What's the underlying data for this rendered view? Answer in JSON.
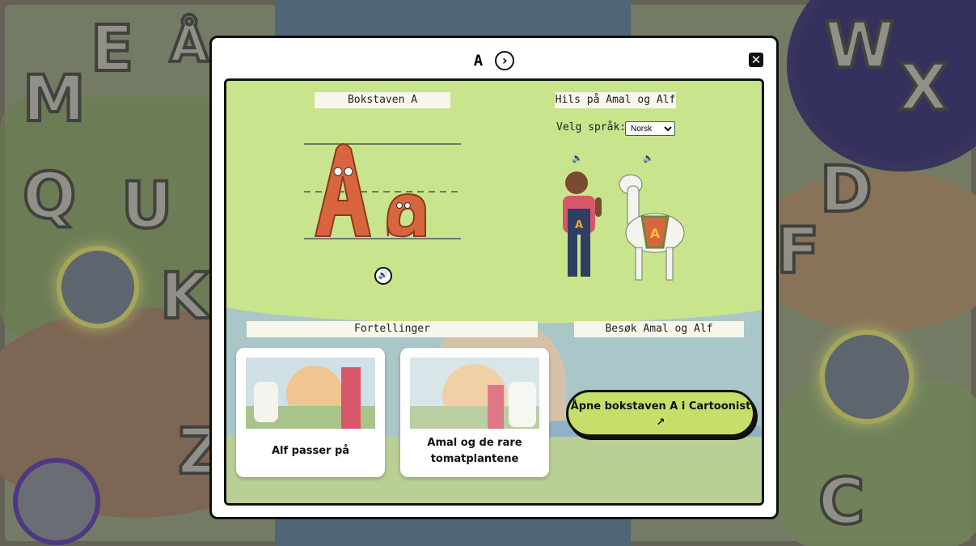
{
  "background": {
    "letters": [
      "M",
      "E",
      "Å",
      "Q",
      "U",
      "K",
      "Z",
      "W",
      "X",
      "D",
      "F",
      "C"
    ]
  },
  "modal": {
    "title": "A",
    "next_icon": "chevron-right-circle-icon",
    "close_icon": "close-icon",
    "letter_section": {
      "label": "Bokstaven A",
      "display_upper": "A",
      "display_lower": "a",
      "sound_icon": "speaker-icon"
    },
    "greet_section": {
      "label": "Hils på Amal og Alf",
      "language_label": "Velg språk:",
      "language_selected": "Norsk",
      "speaker_icon": "speaker-icon"
    },
    "stories": {
      "label": "Fortellinger",
      "items": [
        {
          "title": "Alf passer på"
        },
        {
          "title": "Amal og de rare tomatplantene"
        }
      ]
    },
    "visit": {
      "label": "Besøk Amal og Alf",
      "button_label": "Åpne bokstaven A i Cartoonist",
      "external_icon": "external-link-icon"
    }
  },
  "colors": {
    "panel_green": "#c8e48c",
    "button_green": "#c6df6a",
    "letter_orange": "#d9653f"
  }
}
